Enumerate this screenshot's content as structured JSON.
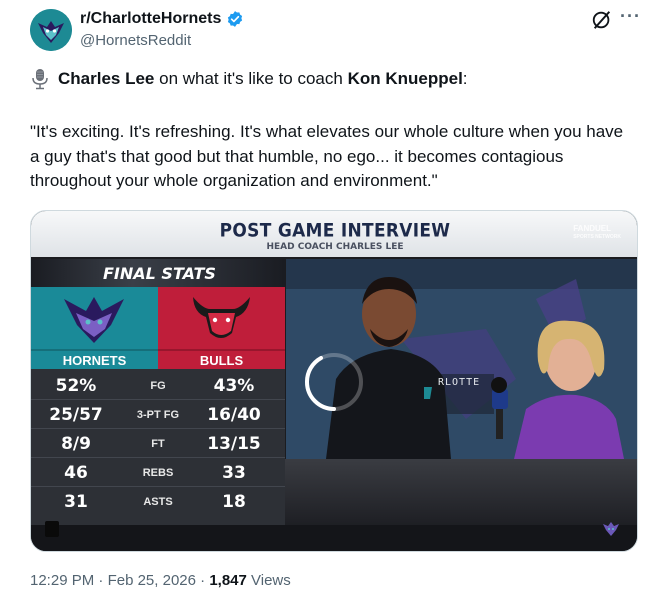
{
  "account": {
    "display_name": "r/CharlotteHornets",
    "handle": "@HornetsReddit"
  },
  "post": {
    "intro_name": "Charles Lee",
    "intro_mid": " on what it's like to coach ",
    "intro_player": "Kon Knueppel",
    "intro_end": ":",
    "quote": "\"It's exciting. It's refreshing. It's what elevates our whole culture when you have a guy that's that good but that humble, no ego... it becomes contagious throughout your whole organization and environment.\""
  },
  "media": {
    "banner_title": "POST GAME INTERVIEW",
    "banner_subtitle": "HEAD COACH CHARLES LEE",
    "brand_line1": "FANDUEL",
    "brand_line2": "SPORTS NETWORK",
    "panel_title": "FINAL STATS",
    "team_left": "HORNETS",
    "team_right": "BULLS",
    "backdrop_text": "RLOTTE",
    "stats": [
      {
        "left": "52%",
        "label": "FG",
        "right": "43%"
      },
      {
        "left": "25/57",
        "label": "3-PT FG",
        "right": "16/40"
      },
      {
        "left": "8/9",
        "label": "FT",
        "right": "13/15"
      },
      {
        "left": "46",
        "label": "REBS",
        "right": "33"
      },
      {
        "left": "31",
        "label": "ASTS",
        "right": "18"
      }
    ]
  },
  "meta": {
    "time": "12:29 PM",
    "sep1": " · ",
    "date": "Feb 25, 2026",
    "sep2": " · ",
    "views_count": "1,847",
    "views_label": " Views"
  },
  "colors": {
    "hornets_teal": "#1a8a98",
    "bulls_red": "#bf1e3a",
    "verified_blue": "#1d9bf0"
  },
  "icons": [
    "verified-badge-icon",
    "grok-icon",
    "more-icon",
    "microphone-icon",
    "loading-spinner-icon",
    "hornets-logo-icon",
    "bulls-logo-icon"
  ]
}
